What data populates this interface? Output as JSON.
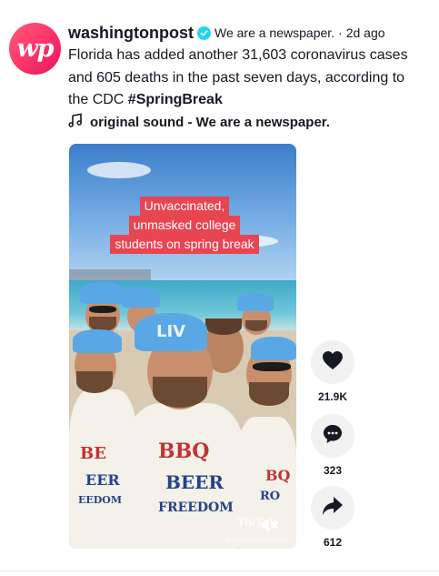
{
  "post": {
    "avatar_text": "wp",
    "username": "washingtonpost",
    "nickname": "We are a newspaper.",
    "separator": "·",
    "time": "2d ago",
    "caption_text": "Florida has added another 31,603 coronavirus cases and 605 deaths in the past seven days, according to the CDC ",
    "hashtag": "#SpringBreak",
    "sound_label": "original sound - We are a newspaper.",
    "icons": {
      "verified": "verified-check-icon",
      "sound": "music-note-icon",
      "like": "heart-icon",
      "comment": "comment-bubble-icon",
      "share": "share-arrow-icon",
      "mute": "muted-speaker-icon"
    }
  },
  "video": {
    "overlay_lines": [
      "Unvaccinated,",
      "unmasked college",
      "students on spring break"
    ],
    "shirt_text_top": "BBQ",
    "shirt_text_mid": "BEER",
    "shirt_text_bottom": "FREEDOM",
    "cap_logo": "LIV",
    "watermark_logo": "TikTok",
    "watermark_user": "@washingtonpost"
  },
  "actions": {
    "likes": "21.9K",
    "comments": "323",
    "shares": "612"
  },
  "colors": {
    "verified": "#20d5ec",
    "overlay_bg": "#e84552",
    "action_bg": "#f1f1f2",
    "avatar_gradient_start": "#ff5b7a",
    "avatar_gradient_end": "#e6165b"
  }
}
